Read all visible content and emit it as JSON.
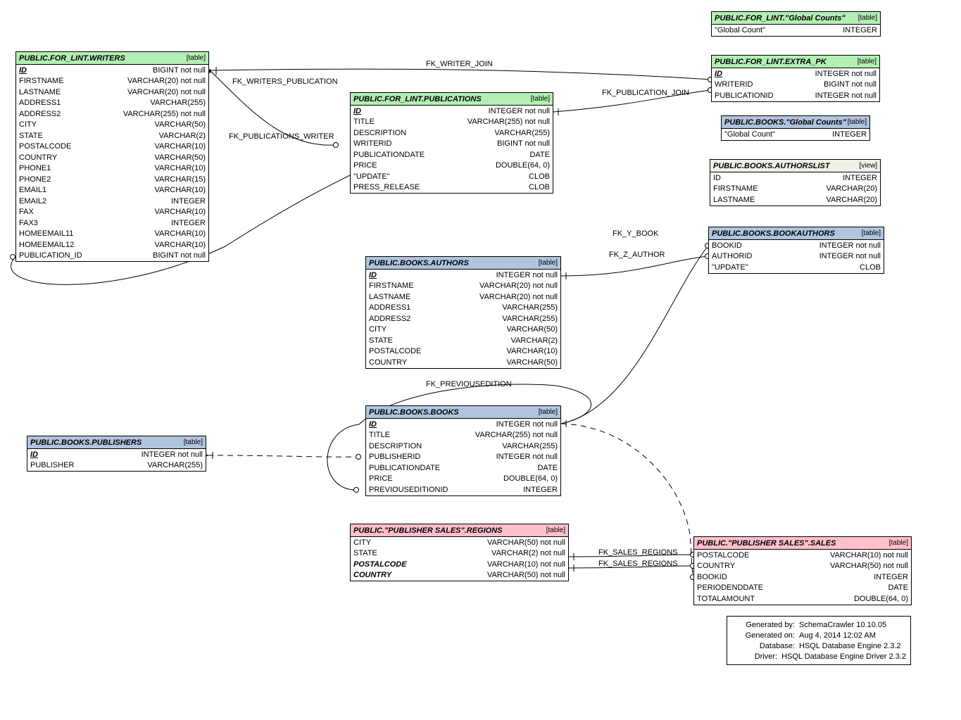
{
  "relationships": {
    "fk_writer_join": "FK_WRITER_JOIN",
    "fk_writers_publication": "FK_WRITERS_PUBLICATION",
    "fk_publications_writer": "FK_PUBLICATIONS_WRITER",
    "fk_publication_join": "FK_PUBLICATION_JOIN",
    "fk_y_book": "FK_Y_BOOK",
    "fk_z_author": "FK_Z_AUTHOR",
    "fk_previousedition": "FK_PREVIOUSEDITION",
    "fk_sales_regions": "FK_SALES_REGIONS",
    "fk_sales_regions2": "FK_SALES_REGIONS"
  },
  "t_global_counts_lint": {
    "title": "PUBLIC.FOR_LINT.\"Global Counts\"",
    "type": "[table]",
    "cols": [
      {
        "n": "\"Global Count\"",
        "t": "INTEGER"
      }
    ]
  },
  "t_extra_pk": {
    "title": "PUBLIC.FOR_LINT.EXTRA_PK",
    "type": "[table]",
    "cols": [
      {
        "n": "ID",
        "t": "INTEGER not null",
        "pk": true
      },
      {
        "n": "WRITERID",
        "t": "BIGINT not null"
      },
      {
        "n": "PUBLICATIONID",
        "t": "INTEGER not null"
      }
    ]
  },
  "t_writers": {
    "title": "PUBLIC.FOR_LINT.WRITERS",
    "type": "[table]",
    "cols": [
      {
        "n": "ID",
        "t": "BIGINT not null",
        "pk": true
      },
      {
        "n": "FIRSTNAME",
        "t": "VARCHAR(20) not null"
      },
      {
        "n": "LASTNAME",
        "t": "VARCHAR(20) not null"
      },
      {
        "n": "ADDRESS1",
        "t": "VARCHAR(255)"
      },
      {
        "n": "ADDRESS2",
        "t": "VARCHAR(255) not null"
      },
      {
        "n": "CITY",
        "t": "VARCHAR(50)"
      },
      {
        "n": "STATE",
        "t": "VARCHAR(2)"
      },
      {
        "n": "POSTALCODE",
        "t": "VARCHAR(10)"
      },
      {
        "n": "COUNTRY",
        "t": "VARCHAR(50)"
      },
      {
        "n": "PHONE1",
        "t": "VARCHAR(10)"
      },
      {
        "n": "PHONE2",
        "t": "VARCHAR(15)"
      },
      {
        "n": "EMAIL1",
        "t": "VARCHAR(10)"
      },
      {
        "n": "EMAIL2",
        "t": "INTEGER"
      },
      {
        "n": "FAX",
        "t": "VARCHAR(10)"
      },
      {
        "n": "FAX3",
        "t": "INTEGER"
      },
      {
        "n": "HOMEEMAIL11",
        "t": "VARCHAR(10)"
      },
      {
        "n": "HOMEEMAIL12",
        "t": "VARCHAR(10)"
      },
      {
        "n": "PUBLICATION_ID",
        "t": "BIGINT not null"
      }
    ]
  },
  "t_publications": {
    "title": "PUBLIC.FOR_LINT.PUBLICATIONS",
    "type": "[table]",
    "cols": [
      {
        "n": "ID",
        "t": "INTEGER not null",
        "pk": true
      },
      {
        "n": "TITLE",
        "t": "VARCHAR(255) not null"
      },
      {
        "n": "DESCRIPTION",
        "t": "VARCHAR(255)"
      },
      {
        "n": "WRITERID",
        "t": "BIGINT not null"
      },
      {
        "n": "PUBLICATIONDATE",
        "t": "DATE"
      },
      {
        "n": "PRICE",
        "t": "DOUBLE(64, 0)"
      },
      {
        "n": "\"UPDATE\"",
        "t": "CLOB"
      },
      {
        "n": "PRESS_RELEASE",
        "t": "CLOB"
      }
    ]
  },
  "t_books_global_counts": {
    "title": "PUBLIC.BOOKS.\"Global Counts\"",
    "type": "[table]",
    "cols": [
      {
        "n": "\"Global Count\"",
        "t": "INTEGER"
      }
    ]
  },
  "t_authorslist": {
    "title": "PUBLIC.BOOKS.AUTHORSLIST",
    "type": "[view]",
    "cols": [
      {
        "n": "ID",
        "t": "INTEGER"
      },
      {
        "n": "FIRSTNAME",
        "t": "VARCHAR(20)"
      },
      {
        "n": "LASTNAME",
        "t": "VARCHAR(20)"
      }
    ]
  },
  "t_bookauthors": {
    "title": "PUBLIC.BOOKS.BOOKAUTHORS",
    "type": "[table]",
    "cols": [
      {
        "n": "BOOKID",
        "t": "INTEGER not null"
      },
      {
        "n": "AUTHORID",
        "t": "INTEGER not null"
      },
      {
        "n": "\"UPDATE\"",
        "t": "CLOB"
      }
    ]
  },
  "t_authors": {
    "title": "PUBLIC.BOOKS.AUTHORS",
    "type": "[table]",
    "cols": [
      {
        "n": "ID",
        "t": "INTEGER not null",
        "pk": true
      },
      {
        "n": "FIRSTNAME",
        "t": "VARCHAR(20) not null"
      },
      {
        "n": "LASTNAME",
        "t": "VARCHAR(20) not null"
      },
      {
        "n": "ADDRESS1",
        "t": "VARCHAR(255)"
      },
      {
        "n": "ADDRESS2",
        "t": "VARCHAR(255)"
      },
      {
        "n": "CITY",
        "t": "VARCHAR(50)"
      },
      {
        "n": "STATE",
        "t": "VARCHAR(2)"
      },
      {
        "n": "POSTALCODE",
        "t": "VARCHAR(10)"
      },
      {
        "n": "COUNTRY",
        "t": "VARCHAR(50)"
      }
    ]
  },
  "t_publishers": {
    "title": "PUBLIC.BOOKS.PUBLISHERS",
    "type": "[table]",
    "cols": [
      {
        "n": "ID",
        "t": "INTEGER not null",
        "pk": true
      },
      {
        "n": "PUBLISHER",
        "t": "VARCHAR(255)"
      }
    ]
  },
  "t_books": {
    "title": "PUBLIC.BOOKS.BOOKS",
    "type": "[table]",
    "cols": [
      {
        "n": "ID",
        "t": "INTEGER not null",
        "pk": true
      },
      {
        "n": "TITLE",
        "t": "VARCHAR(255) not null"
      },
      {
        "n": "DESCRIPTION",
        "t": "VARCHAR(255)"
      },
      {
        "n": "PUBLISHERID",
        "t": "INTEGER not null"
      },
      {
        "n": "PUBLICATIONDATE",
        "t": "DATE"
      },
      {
        "n": "PRICE",
        "t": "DOUBLE(64, 0)"
      },
      {
        "n": "PREVIOUSEDITIONID",
        "t": "INTEGER"
      }
    ]
  },
  "t_regions": {
    "title": "PUBLIC.\"PUBLISHER SALES\".REGIONS",
    "type": "[table]",
    "cols": [
      {
        "n": "CITY",
        "t": "VARCHAR(50) not null"
      },
      {
        "n": "STATE",
        "t": "VARCHAR(2) not null"
      },
      {
        "n": "POSTALCODE",
        "t": "VARCHAR(10) not null",
        "bold": true
      },
      {
        "n": "COUNTRY",
        "t": "VARCHAR(50) not null",
        "bold": true
      }
    ]
  },
  "t_sales": {
    "title": "PUBLIC.\"PUBLISHER SALES\".SALES",
    "type": "[table]",
    "cols": [
      {
        "n": "POSTALCODE",
        "t": "VARCHAR(10) not null"
      },
      {
        "n": "COUNTRY",
        "t": "VARCHAR(50) not null"
      },
      {
        "n": "BOOKID",
        "t": "INTEGER"
      },
      {
        "n": "PERIODENDDATE",
        "t": "DATE"
      },
      {
        "n": "TOTALAMOUNT",
        "t": "DOUBLE(64, 0)"
      }
    ]
  },
  "info": {
    "gen_by_label": "Generated by:",
    "gen_by": "SchemaCrawler 10.10.05",
    "gen_on_label": "Generated on:",
    "gen_on": "Aug 4, 2014 12:02 AM",
    "db_label": "Database:",
    "db": "HSQL Database Engine  2.3.2",
    "drv_label": "Driver:",
    "drv": "HSQL Database Engine Driver  2.3.2"
  },
  "chart_data": {
    "type": "erd",
    "entities": [
      {
        "name": "PUBLIC.FOR_LINT.\"Global Counts\"",
        "kind": "table",
        "header_color": "green"
      },
      {
        "name": "PUBLIC.FOR_LINT.EXTRA_PK",
        "kind": "table",
        "header_color": "green"
      },
      {
        "name": "PUBLIC.FOR_LINT.WRITERS",
        "kind": "table",
        "header_color": "green"
      },
      {
        "name": "PUBLIC.FOR_LINT.PUBLICATIONS",
        "kind": "table",
        "header_color": "green"
      },
      {
        "name": "PUBLIC.BOOKS.\"Global Counts\"",
        "kind": "table",
        "header_color": "blue"
      },
      {
        "name": "PUBLIC.BOOKS.AUTHORSLIST",
        "kind": "view",
        "header_color": "grey"
      },
      {
        "name": "PUBLIC.BOOKS.BOOKAUTHORS",
        "kind": "table",
        "header_color": "blue"
      },
      {
        "name": "PUBLIC.BOOKS.AUTHORS",
        "kind": "table",
        "header_color": "blue"
      },
      {
        "name": "PUBLIC.BOOKS.PUBLISHERS",
        "kind": "table",
        "header_color": "blue"
      },
      {
        "name": "PUBLIC.BOOKS.BOOKS",
        "kind": "table",
        "header_color": "blue"
      },
      {
        "name": "PUBLIC.\"PUBLISHER SALES\".REGIONS",
        "kind": "table",
        "header_color": "pink"
      },
      {
        "name": "PUBLIC.\"PUBLISHER SALES\".SALES",
        "kind": "table",
        "header_color": "pink"
      }
    ],
    "relations": [
      {
        "name": "FK_WRITER_JOIN",
        "from": "PUBLIC.FOR_LINT.EXTRA_PK.WRITERID",
        "to": "PUBLIC.FOR_LINT.WRITERS.ID"
      },
      {
        "name": "FK_PUBLICATION_JOIN",
        "from": "PUBLIC.FOR_LINT.EXTRA_PK.PUBLICATIONID",
        "to": "PUBLIC.FOR_LINT.PUBLICATIONS.ID"
      },
      {
        "name": "FK_WRITERS_PUBLICATION",
        "from": "PUBLIC.FOR_LINT.WRITERS.PUBLICATION_ID",
        "to": "PUBLIC.FOR_LINT.PUBLICATIONS.ID"
      },
      {
        "name": "FK_PUBLICATIONS_WRITER",
        "from": "PUBLIC.FOR_LINT.PUBLICATIONS.WRITERID",
        "to": "PUBLIC.FOR_LINT.WRITERS.ID"
      },
      {
        "name": "FK_Y_BOOK",
        "from": "PUBLIC.BOOKS.BOOKAUTHORS.BOOKID",
        "to": "PUBLIC.BOOKS.BOOKS.ID"
      },
      {
        "name": "FK_Z_AUTHOR",
        "from": "PUBLIC.BOOKS.BOOKAUTHORS.AUTHORID",
        "to": "PUBLIC.BOOKS.AUTHORS.ID"
      },
      {
        "name": "FK_PREVIOUSEDITION",
        "from": "PUBLIC.BOOKS.BOOKS.PREVIOUSEDITIONID",
        "to": "PUBLIC.BOOKS.BOOKS.ID"
      },
      {
        "name": "(publisher-books)",
        "from": "PUBLIC.BOOKS.BOOKS.PUBLISHERID",
        "to": "PUBLIC.BOOKS.PUBLISHERS.ID",
        "style": "dashed"
      },
      {
        "name": "FK_SALES_REGIONS",
        "from": "PUBLIC.\"PUBLISHER SALES\".SALES.POSTALCODE",
        "to": "PUBLIC.\"PUBLISHER SALES\".REGIONS.POSTALCODE"
      },
      {
        "name": "FK_SALES_REGIONS",
        "from": "PUBLIC.\"PUBLISHER SALES\".SALES.COUNTRY",
        "to": "PUBLIC.\"PUBLISHER SALES\".REGIONS.COUNTRY"
      },
      {
        "name": "(sales-books)",
        "from": "PUBLIC.\"PUBLISHER SALES\".SALES.BOOKID",
        "to": "PUBLIC.BOOKS.BOOKS.ID",
        "style": "dashed"
      }
    ]
  }
}
